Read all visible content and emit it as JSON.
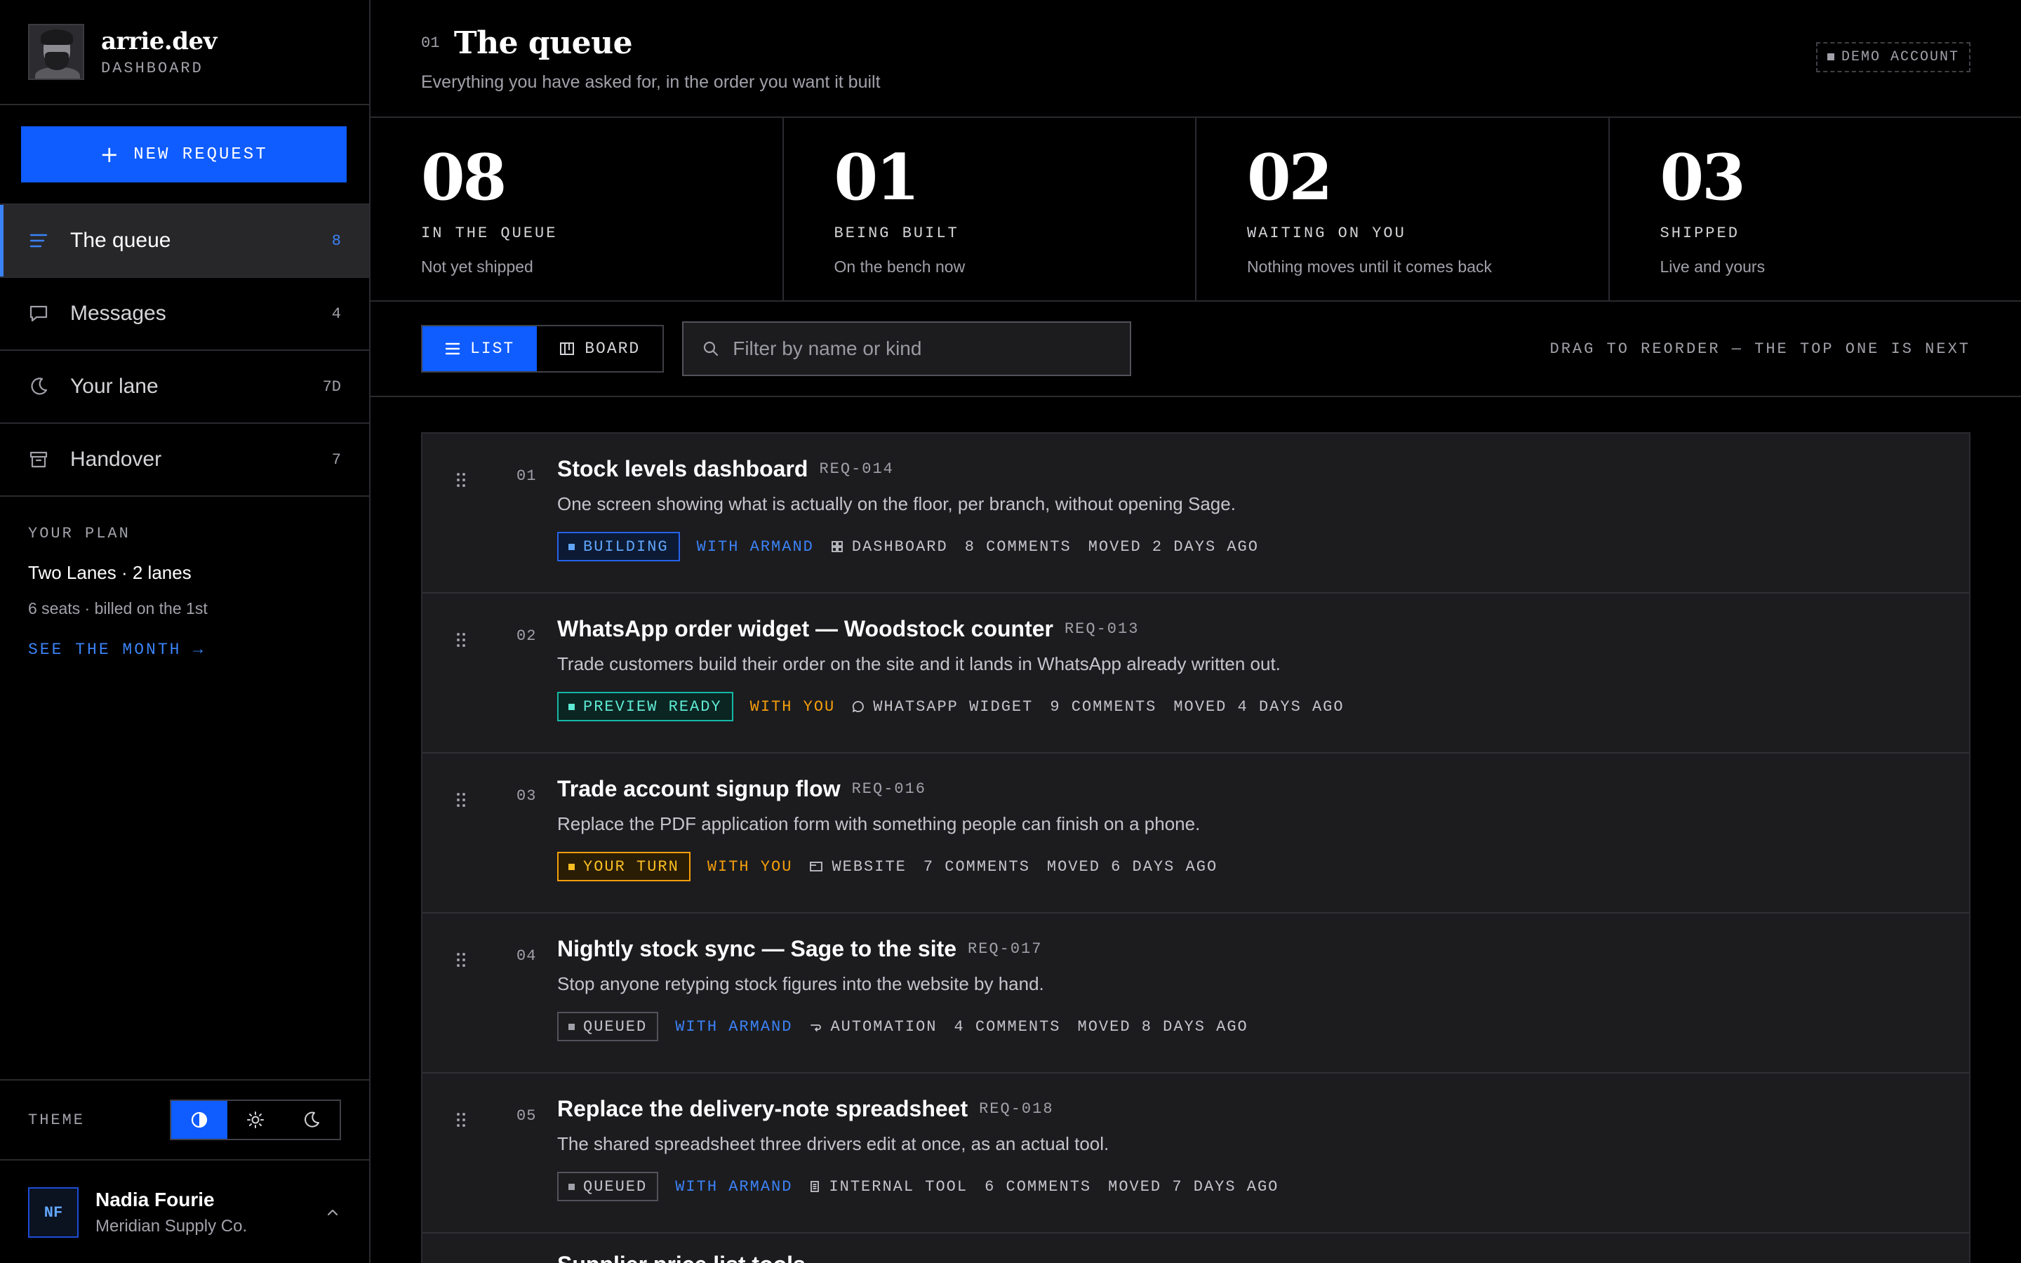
{
  "brand": {
    "name": "arrie.dev",
    "sub": "DASHBOARD"
  },
  "sidebar": {
    "new_request": "NEW REQUEST",
    "items": [
      {
        "label": "The queue",
        "count": "8",
        "icon": "list-icon"
      },
      {
        "label": "Messages",
        "count": "4",
        "icon": "message-icon"
      },
      {
        "label": "Your lane",
        "count": "7D",
        "icon": "moon-icon"
      },
      {
        "label": "Handover",
        "count": "7",
        "icon": "archive-icon"
      }
    ],
    "plan": {
      "eyebrow": "YOUR PLAN",
      "name": "Two Lanes · 2 lanes",
      "meta": "6 seats · billed on the 1st",
      "link": "SEE THE MONTH →"
    },
    "theme": {
      "label": "THEME",
      "options": [
        "contrast-icon",
        "sun-icon",
        "moon-icon"
      ],
      "selected": "contrast-icon"
    },
    "user": {
      "initials": "NF",
      "name": "Nadia Fourie",
      "org": "Meridian Supply Co."
    }
  },
  "header": {
    "num": "01",
    "title": "The queue",
    "subtitle": "Everything you have asked for, in the order you want it built",
    "badge": "DEMO ACCOUNT"
  },
  "stats": [
    {
      "value": "08",
      "label": "IN THE QUEUE",
      "note": "Not yet shipped"
    },
    {
      "value": "01",
      "label": "BEING BUILT",
      "note": "On the bench now"
    },
    {
      "value": "02",
      "label": "WAITING ON YOU",
      "note": "Nothing moves until it comes back"
    },
    {
      "value": "03",
      "label": "SHIPPED",
      "note": "Live and yours"
    }
  ],
  "toolbar": {
    "list": "LIST",
    "board": "BOARD",
    "search_placeholder": "Filter by name or kind",
    "hint": "DRAG TO REORDER — THE TOP ONE IS NEXT"
  },
  "queue": [
    {
      "num": "01",
      "title": "Stock levels dashboard",
      "id": "REQ-014",
      "desc": "One screen showing what is actually on the floor, per branch, without opening Sage.",
      "status": "BUILDING",
      "owner": "WITH ARMAND",
      "kind": "DASHBOARD",
      "comments": "8 COMMENTS",
      "moved": "MOVED 2 DAYS AGO"
    },
    {
      "num": "02",
      "title": "WhatsApp order widget — Woodstock counter",
      "id": "REQ-013",
      "desc": "Trade customers build their order on the site and it lands in WhatsApp already written out.",
      "status": "PREVIEW READY",
      "owner": "WITH YOU",
      "kind": "WHATSAPP WIDGET",
      "comments": "9 COMMENTS",
      "moved": "MOVED 4 DAYS AGO"
    },
    {
      "num": "03",
      "title": "Trade account signup flow",
      "id": "REQ-016",
      "desc": "Replace the PDF application form with something people can finish on a phone.",
      "status": "YOUR TURN",
      "owner": "WITH YOU",
      "kind": "WEBSITE",
      "comments": "7 COMMENTS",
      "moved": "MOVED 6 DAYS AGO"
    },
    {
      "num": "04",
      "title": "Nightly stock sync — Sage to the site",
      "id": "REQ-017",
      "desc": "Stop anyone retyping stock figures into the website by hand.",
      "status": "QUEUED",
      "owner": "WITH ARMAND",
      "kind": "AUTOMATION",
      "comments": "4 COMMENTS",
      "moved": "MOVED 8 DAYS AGO"
    },
    {
      "num": "05",
      "title": "Replace the delivery-note spreadsheet",
      "id": "REQ-018",
      "desc": "The shared spreadsheet three drivers edit at once, as an actual tool.",
      "status": "QUEUED",
      "owner": "WITH ARMAND",
      "kind": "INTERNAL TOOL",
      "comments": "6 COMMENTS",
      "moved": "MOVED 7 DAYS AGO"
    }
  ],
  "queue_peek": "Supplier price list tools"
}
